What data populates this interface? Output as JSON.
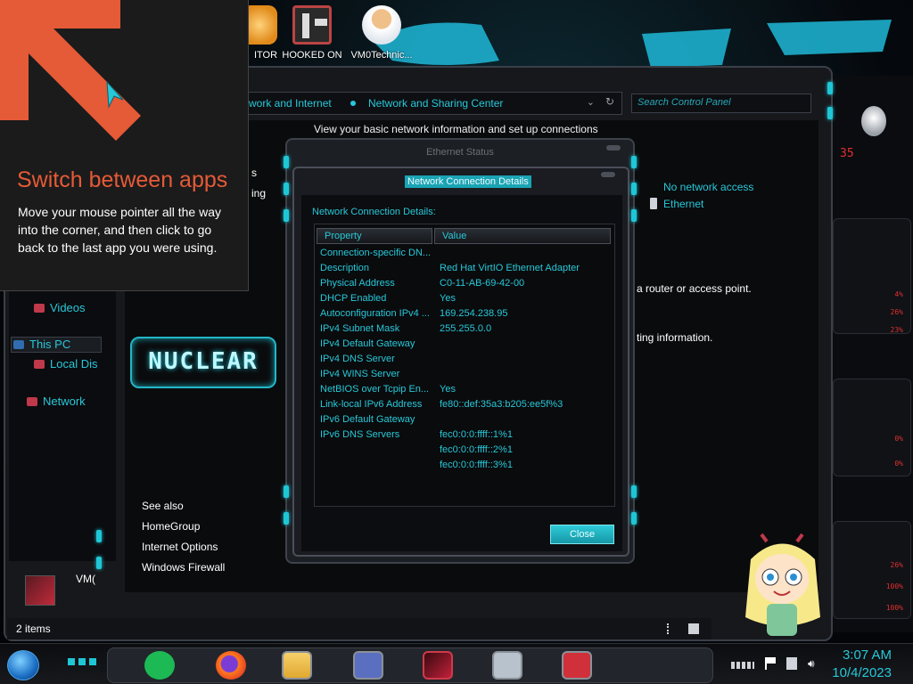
{
  "desktop": {
    "icons": [
      {
        "label": "ITOR",
        "icon": "app-icon"
      },
      {
        "label": "HOOKED ON",
        "icon": "maze-game-icon"
      },
      {
        "label": "VM0Technic...",
        "icon": "doctor-icon"
      }
    ]
  },
  "explorer": {
    "breadcrumb": [
      "work and Internet",
      "Network and Sharing Center"
    ],
    "search_placeholder": "Search Control Panel",
    "header_text": "View your basic network information and set up connections",
    "nav": {
      "videos": "Videos",
      "this_pc": "This PC",
      "local_disk": "Local Dis",
      "network": "Network",
      "partial_1": "s",
      "partial_2": "ing",
      "vm_label": "VM("
    },
    "see_also": {
      "heading": "See also",
      "links": [
        "HomeGroup",
        "Internet Options",
        "Windows Firewall"
      ]
    },
    "right_pane": {
      "access": "No network access",
      "connection": "Ethernet",
      "router_text": "a router or access point.",
      "info_text": "ting information."
    },
    "status": "2 items",
    "logo_text": "NUCLEAR"
  },
  "ethernet_status": {
    "title": "Ethernet Status"
  },
  "details_dialog": {
    "title": "Network Connection Details",
    "heading": "Network Connection Details:",
    "columns": [
      "Property",
      "Value"
    ],
    "rows": [
      {
        "property": "Connection-specific DN...",
        "value": ""
      },
      {
        "property": "Description",
        "value": "Red Hat VirtIO Ethernet Adapter"
      },
      {
        "property": "Physical Address",
        "value": "C0-11-AB-69-42-00"
      },
      {
        "property": "DHCP Enabled",
        "value": "Yes"
      },
      {
        "property": "Autoconfiguration IPv4 ...",
        "value": "169.254.238.95"
      },
      {
        "property": "IPv4 Subnet Mask",
        "value": "255.255.0.0"
      },
      {
        "property": "IPv4 Default Gateway",
        "value": ""
      },
      {
        "property": "IPv4 DNS Server",
        "value": ""
      },
      {
        "property": "IPv4 WINS Server",
        "value": ""
      },
      {
        "property": "NetBIOS over Tcpip En...",
        "value": "Yes"
      },
      {
        "property": "Link-local IPv6 Address",
        "value": "fe80::def:35a3:b205:ee5f%3"
      },
      {
        "property": "IPv6 Default Gateway",
        "value": ""
      },
      {
        "property": "IPv6 DNS Servers",
        "value": "fec0:0:0:ffff::1%1"
      },
      {
        "property": "",
        "value": "fec0:0:0:ffff::2%1"
      },
      {
        "property": "",
        "value": "fec0:0:0:ffff::3%1"
      }
    ],
    "close_label": "Close"
  },
  "tooltip": {
    "title": "Switch between apps",
    "body": "Move your mouse pointer all the way into the corner, and then click to go back to the last app you were using."
  },
  "gadgets": {
    "top_number": "35",
    "readouts": [
      "4%",
      "26%",
      "23%",
      "0%",
      "0%",
      "26%",
      "100%",
      "100%"
    ]
  },
  "taskbar": {
    "apps": [
      "spotify-icon",
      "firefox-icon",
      "file-explorer-icon",
      "control-panel-icon",
      "game-icon",
      "performance-monitor-icon",
      "news-icon"
    ],
    "time": "3:07 AM",
    "date": "10/4/2023"
  },
  "colors": {
    "accent": "#27c8d8",
    "tooltip_title": "#e55a37",
    "gadget_red": "#e03030"
  }
}
